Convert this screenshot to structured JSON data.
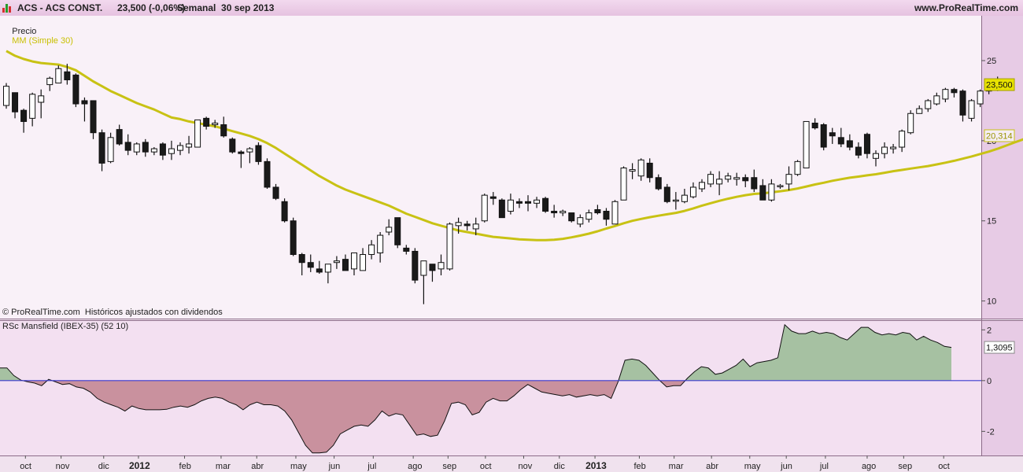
{
  "header": {
    "instrument": "ACS - ACS CONST.",
    "price_change": "23,500 (-0,06%)",
    "period": "Semanal  30 sep 2013",
    "site": "www.ProRealTime.com"
  },
  "price_panel": {
    "label_price": "Precio",
    "label_ma": "MM (Simple 30)",
    "watermark": "© ProRealTime.com  Históricos ajustados con dividendos",
    "last_price_tag": "23,500",
    "ma_tag": "20,314"
  },
  "rs_panel": {
    "label": "RSc Mansfield (IBEX-35) (52 10)",
    "value_tag": "1,3095"
  },
  "colors": {
    "up_candle": "#ffffff",
    "down_candle": "#1a1a1a",
    "ma_line": "#c8c214",
    "positive_fill": "#a6c1a2",
    "negative_fill": "#c9919e",
    "zero_line": "#3a3ad0",
    "background_price": "#f9f1f8",
    "background_rs": "#f3e0f1"
  },
  "chart_data": [
    {
      "type": "candlestick",
      "title": "ACS - ACS CONST.",
      "period": "weekly",
      "y_axis": {
        "ticks": [
          10,
          15,
          20,
          25
        ],
        "range": [
          8.9,
          27.8
        ]
      },
      "x_axis": {
        "ticks": [
          "oct",
          "nov",
          "dic",
          "2012",
          "feb",
          "mar",
          "abr",
          "may",
          "jun",
          "jul",
          "ago",
          "sep",
          "oct",
          "nov",
          "dic",
          "2013",
          "feb",
          "mar",
          "abr",
          "may",
          "jun",
          "jul",
          "ago",
          "sep",
          "oct"
        ],
        "bold_ticks": [
          "2012",
          "2013"
        ]
      },
      "series": [
        {
          "name": "Precio",
          "ohlc": [
            [
              22.2,
              23.6,
              22.0,
              23.4
            ],
            [
              23.0,
              23.0,
              21.4,
              21.8
            ],
            [
              21.9,
              22.0,
              20.5,
              21.2
            ],
            [
              21.4,
              23.0,
              20.9,
              22.9
            ],
            [
              22.4,
              23.2,
              21.4,
              22.8
            ],
            [
              23.5,
              24.0,
              23.1,
              23.9
            ],
            [
              23.6,
              24.7,
              23.6,
              24.5
            ],
            [
              24.3,
              24.8,
              23.5,
              23.8
            ],
            [
              24.1,
              24.2,
              22.1,
              22.3
            ],
            [
              22.5,
              22.7,
              21.2,
              22.3
            ],
            [
              22.5,
              22.5,
              20.1,
              20.5
            ],
            [
              20.5,
              20.7,
              18.1,
              18.6
            ],
            [
              18.7,
              20.5,
              18.6,
              20.2
            ],
            [
              20.7,
              21.0,
              19.7,
              19.8
            ],
            [
              19.9,
              20.4,
              19.1,
              19.4
            ],
            [
              19.3,
              19.9,
              19.1,
              19.8
            ],
            [
              19.9,
              20.1,
              19.0,
              19.3
            ],
            [
              19.3,
              19.6,
              19.1,
              19.5
            ],
            [
              19.8,
              19.9,
              18.8,
              19.1
            ],
            [
              19.2,
              20.0,
              18.8,
              19.5
            ],
            [
              19.4,
              19.9,
              19.1,
              19.7
            ],
            [
              19.6,
              20.3,
              19.2,
              19.8
            ],
            [
              19.6,
              21.3,
              19.6,
              21.3
            ],
            [
              21.4,
              21.5,
              20.7,
              20.9
            ],
            [
              21.0,
              21.3,
              20.8,
              21.1
            ],
            [
              21.0,
              21.5,
              20.2,
              20.3
            ],
            [
              20.1,
              20.2,
              19.2,
              19.3
            ],
            [
              19.3,
              19.4,
              18.3,
              19.2
            ],
            [
              19.3,
              19.6,
              18.6,
              19.5
            ],
            [
              19.7,
              19.9,
              18.5,
              18.7
            ],
            [
              18.7,
              18.9,
              17.0,
              17.1
            ],
            [
              17.1,
              17.3,
              16.3,
              16.4
            ],
            [
              16.2,
              16.4,
              14.9,
              15.0
            ],
            [
              15.0,
              15.2,
              12.8,
              12.9
            ],
            [
              12.9,
              13.0,
              11.6,
              12.4
            ],
            [
              12.4,
              12.9,
              11.8,
              12.1
            ],
            [
              12.0,
              12.5,
              11.7,
              11.8
            ],
            [
              11.8,
              12.3,
              11.1,
              12.3
            ],
            [
              12.4,
              12.8,
              12.0,
              12.5
            ],
            [
              12.6,
              12.9,
              11.9,
              11.9
            ],
            [
              12.0,
              12.9,
              11.6,
              13.0
            ],
            [
              11.9,
              13.3,
              11.9,
              12.9
            ],
            [
              12.9,
              13.8,
              12.6,
              13.5
            ],
            [
              13.0,
              14.3,
              12.4,
              14.1
            ],
            [
              14.3,
              15.1,
              14.1,
              14.6
            ],
            [
              15.2,
              15.2,
              13.3,
              13.5
            ],
            [
              13.3,
              13.5,
              12.9,
              13.1
            ],
            [
              13.1,
              13.3,
              11.1,
              11.3
            ],
            [
              11.6,
              12.3,
              9.8,
              12.5
            ],
            [
              12.3,
              12.3,
              11.2,
              11.9
            ],
            [
              12.0,
              12.9,
              11.6,
              12.4
            ],
            [
              12.0,
              14.9,
              11.9,
              14.8
            ],
            [
              14.7,
              15.2,
              14.2,
              14.9
            ],
            [
              14.8,
              15.0,
              14.4,
              14.7
            ],
            [
              14.5,
              15.2,
              14.1,
              14.8
            ],
            [
              15.0,
              16.7,
              14.9,
              16.6
            ],
            [
              16.5,
              16.8,
              16.0,
              16.4
            ],
            [
              16.3,
              16.4,
              15.2,
              15.2
            ],
            [
              15.6,
              16.7,
              15.4,
              16.3
            ],
            [
              16.2,
              16.4,
              15.8,
              16.1
            ],
            [
              16.2,
              16.6,
              15.6,
              16.1
            ],
            [
              16.1,
              16.5,
              15.8,
              16.3
            ],
            [
              16.4,
              16.5,
              15.5,
              15.6
            ],
            [
              15.6,
              16.0,
              15.2,
              15.5
            ],
            [
              15.5,
              15.7,
              15.3,
              15.6
            ],
            [
              15.5,
              15.5,
              14.9,
              15.0
            ],
            [
              14.8,
              15.4,
              14.6,
              15.2
            ],
            [
              15.1,
              15.7,
              14.9,
              15.5
            ],
            [
              15.7,
              16.0,
              15.4,
              15.5
            ],
            [
              15.6,
              15.8,
              14.7,
              15.1
            ],
            [
              14.8,
              16.3,
              14.8,
              16.2
            ],
            [
              16.3,
              18.4,
              16.3,
              18.3
            ],
            [
              18.1,
              18.6,
              17.6,
              18.2
            ],
            [
              17.8,
              18.9,
              17.5,
              18.8
            ],
            [
              18.6,
              18.9,
              17.4,
              17.7
            ],
            [
              17.7,
              17.9,
              16.9,
              17.0
            ],
            [
              17.1,
              17.3,
              16.1,
              16.2
            ],
            [
              16.3,
              16.8,
              15.7,
              16.3
            ],
            [
              16.2,
              17.0,
              16.1,
              16.6
            ],
            [
              16.5,
              17.4,
              16.4,
              17.1
            ],
            [
              17.0,
              17.6,
              16.8,
              17.4
            ],
            [
              17.3,
              18.1,
              17.1,
              17.9
            ],
            [
              17.3,
              18.1,
              16.6,
              17.6
            ],
            [
              17.6,
              18.0,
              17.4,
              17.8
            ],
            [
              17.6,
              18.0,
              17.2,
              17.7
            ],
            [
              17.7,
              17.9,
              17.1,
              17.5
            ],
            [
              17.7,
              18.2,
              16.8,
              17.0
            ],
            [
              17.2,
              17.6,
              16.6,
              16.3
            ],
            [
              16.3,
              17.6,
              16.2,
              17.3
            ],
            [
              17.2,
              17.3,
              17.0,
              17.2
            ],
            [
              17.3,
              18.4,
              16.9,
              17.9
            ],
            [
              17.9,
              18.8,
              17.8,
              18.7
            ],
            [
              18.3,
              21.2,
              18.3,
              21.2
            ],
            [
              21.1,
              21.4,
              20.7,
              20.8
            ],
            [
              21.0,
              21.1,
              19.4,
              19.6
            ],
            [
              20.5,
              20.8,
              19.8,
              20.3
            ],
            [
              20.2,
              20.8,
              19.6,
              19.8
            ],
            [
              20.0,
              20.4,
              19.4,
              19.6
            ],
            [
              19.6,
              19.9,
              18.9,
              19.1
            ],
            [
              20.4,
              20.5,
              18.9,
              19.2
            ],
            [
              18.9,
              19.4,
              18.4,
              19.2
            ],
            [
              19.2,
              19.9,
              18.9,
              19.6
            ],
            [
              19.5,
              19.8,
              19.2,
              19.6
            ],
            [
              19.6,
              20.7,
              19.3,
              20.6
            ],
            [
              20.5,
              21.9,
              20.4,
              21.7
            ],
            [
              21.7,
              22.2,
              21.7,
              22.0
            ],
            [
              22.0,
              22.6,
              21.8,
              22.5
            ],
            [
              22.3,
              23.0,
              22.2,
              22.8
            ],
            [
              22.6,
              23.3,
              22.4,
              23.2
            ],
            [
              23.2,
              23.3,
              22.7,
              23.0
            ],
            [
              23.1,
              23.2,
              21.2,
              21.6
            ],
            [
              21.4,
              22.6,
              21.2,
              22.5
            ],
            [
              22.3,
              23.2,
              22.1,
              23.1
            ],
            [
              23.1,
              23.8,
              22.9,
              23.6
            ],
            [
              23.6,
              24.0,
              23.1,
              23.4
            ],
            [
              23.5,
              23.6,
              23.3,
              23.5
            ]
          ]
        },
        {
          "name": "MM (Simple 30)",
          "values": [
            25.6,
            25.3,
            25.1,
            24.95,
            24.85,
            24.8,
            24.75,
            24.6,
            24.4,
            24.05,
            23.7,
            23.4,
            23.1,
            22.85,
            22.6,
            22.35,
            22.15,
            21.95,
            21.7,
            21.45,
            21.35,
            21.2,
            21.1,
            21.0,
            20.9,
            20.75,
            20.6,
            20.45,
            20.3,
            20.1,
            19.85,
            19.55,
            19.2,
            18.85,
            18.5,
            18.15,
            17.8,
            17.5,
            17.2,
            16.95,
            16.75,
            16.55,
            16.35,
            16.15,
            15.95,
            15.7,
            15.45,
            15.25,
            15.05,
            14.85,
            14.7,
            14.55,
            14.4,
            14.3,
            14.2,
            14.1,
            14.0,
            13.95,
            13.9,
            13.85,
            13.82,
            13.8,
            13.8,
            13.82,
            13.88,
            13.97,
            14.08,
            14.2,
            14.35,
            14.52,
            14.68,
            14.85,
            15.0,
            15.12,
            15.23,
            15.32,
            15.41,
            15.5,
            15.62,
            15.78,
            15.95,
            16.1,
            16.25,
            16.38,
            16.5,
            16.6,
            16.68,
            16.72,
            16.78,
            16.85,
            16.92,
            17.02,
            17.14,
            17.27,
            17.38,
            17.5,
            17.6,
            17.69,
            17.76,
            17.84,
            17.91,
            18.0,
            18.1,
            18.18,
            18.26,
            18.34,
            18.42,
            18.52,
            18.63,
            18.75,
            18.88,
            19.02,
            19.17,
            19.32,
            19.5,
            19.7,
            19.9,
            20.1,
            20.314
          ]
        }
      ]
    },
    {
      "type": "area",
      "title": "RSc Mansfield (IBEX-35) (52 10)",
      "y_axis": {
        "ticks": [
          2,
          0,
          -2
        ],
        "range": [
          -2.95,
          2.35
        ]
      },
      "series": [
        {
          "name": "RSc Mansfield (IBEX-35)",
          "values": [
            0.5,
            0.5,
            0.2,
            0.02,
            -0.05,
            -0.1,
            -0.2,
            0.05,
            -0.05,
            -0.15,
            -0.12,
            -0.25,
            -0.3,
            -0.45,
            -0.7,
            -0.85,
            -0.95,
            -1.05,
            -1.2,
            -1.0,
            -1.1,
            -1.15,
            -1.15,
            -1.15,
            -1.13,
            -1.05,
            -1.0,
            -1.05,
            -0.95,
            -0.8,
            -0.7,
            -0.65,
            -0.7,
            -0.85,
            -0.95,
            -1.15,
            -0.95,
            -0.85,
            -0.95,
            -0.95,
            -1.0,
            -1.2,
            -1.55,
            -2.05,
            -2.55,
            -2.85,
            -2.85,
            -2.82,
            -2.55,
            -2.1,
            -1.95,
            -1.8,
            -1.75,
            -1.8,
            -1.55,
            -1.2,
            -1.4,
            -1.3,
            -1.35,
            -1.75,
            -2.15,
            -2.1,
            -2.2,
            -2.15,
            -1.6,
            -0.9,
            -0.85,
            -0.95,
            -1.35,
            -1.25,
            -0.85,
            -0.7,
            -0.8,
            -0.8,
            -0.6,
            -0.35,
            -0.15,
            -0.3,
            -0.45,
            -0.5,
            -0.55,
            -0.6,
            -0.55,
            -0.65,
            -0.6,
            -0.55,
            -0.6,
            -0.55,
            -0.7,
            -0.05,
            0.8,
            0.85,
            0.8,
            0.6,
            0.3,
            0.0,
            -0.25,
            -0.2,
            -0.2,
            0.1,
            0.35,
            0.55,
            0.5,
            0.25,
            0.3,
            0.45,
            0.6,
            0.85,
            0.55,
            0.7,
            0.75,
            0.8,
            0.9,
            2.2,
            1.95,
            1.85,
            1.85,
            1.95,
            1.85,
            1.9,
            1.85,
            1.7,
            1.6,
            1.85,
            2.1,
            2.1,
            1.9,
            1.8,
            1.85,
            1.8,
            1.9,
            1.85,
            1.6,
            1.75,
            1.6,
            1.5,
            1.35,
            1.3095
          ]
        }
      ]
    }
  ]
}
